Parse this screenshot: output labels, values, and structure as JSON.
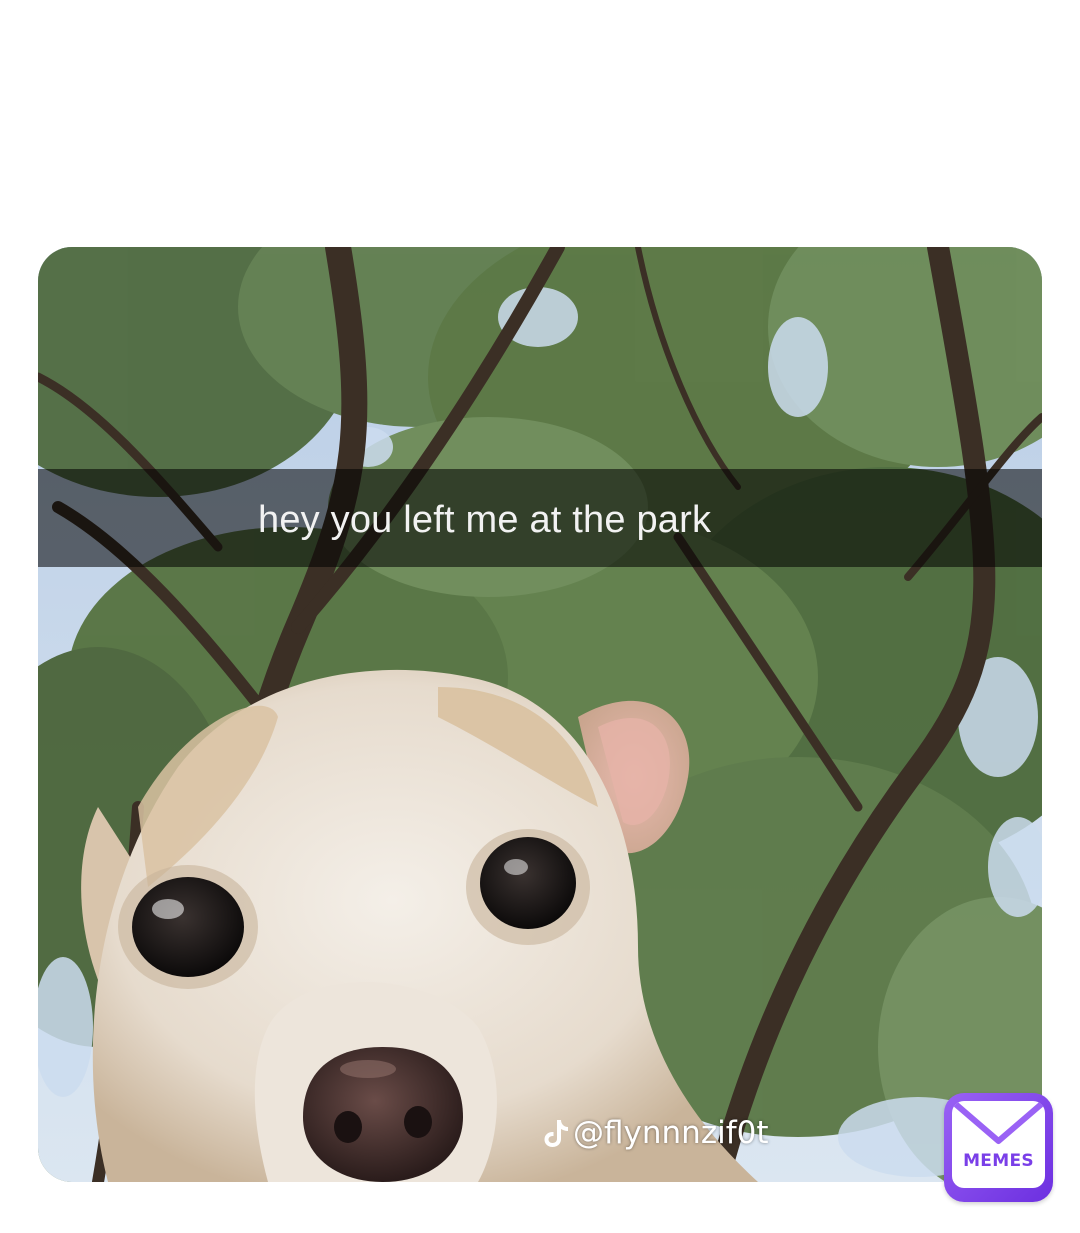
{
  "meme": {
    "caption": "hey you left me at the park",
    "watermark_handle": "@flynnnzif0t",
    "watermark_icon": "tiktok-icon",
    "badge_label": "MEMES",
    "badge_icon": "envelope-icon"
  },
  "colors": {
    "badge_purple": "#7a3fe8",
    "caption_bar": "rgba(0,0,0,0.55)",
    "background": "#ffffff"
  }
}
